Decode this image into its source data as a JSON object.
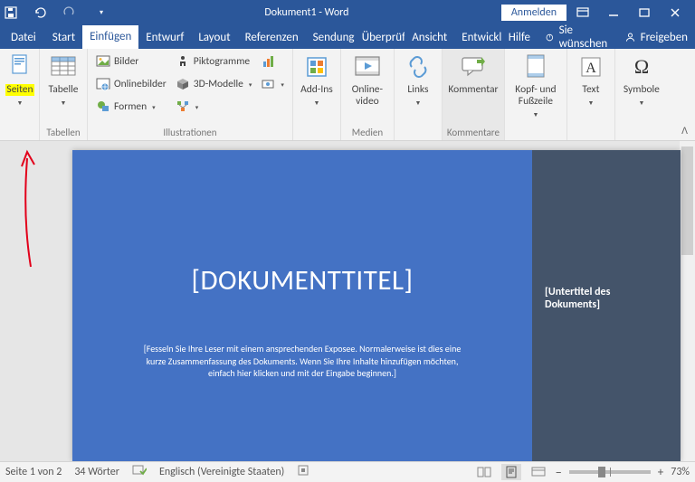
{
  "titlebar": {
    "doc": "Dokument1 - Word",
    "signin": "Anmelden"
  },
  "tabs": {
    "file": "Datei",
    "home": "Start",
    "insert": "Einfügen",
    "design": "Entwurf",
    "layout": "Layout",
    "references": "Referenzen",
    "mailings": "Sendungen",
    "review": "Überprüfen",
    "view": "Ansicht",
    "developer": "Entwickler",
    "help": "Hilfe",
    "tellme": "Sie wünschen",
    "share": "Freigeben"
  },
  "ribbon": {
    "pages": {
      "label": "Seiten"
    },
    "tables": {
      "btn": "Tabelle",
      "label": "Tabellen"
    },
    "illustrations": {
      "pictures": "Bilder",
      "online": "Onlinebilder",
      "shapes": "Formen",
      "icons": "Piktogramme",
      "models": "3D-Modelle",
      "label": "Illustrationen"
    },
    "addins": {
      "btn": "Add-Ins",
      "label": ""
    },
    "video": {
      "btn": "Online-video",
      "label": "Medien"
    },
    "links": {
      "btn": "Links"
    },
    "comment": {
      "btn": "Kommentar",
      "label": "Kommentare"
    },
    "header": {
      "btn": "Kopf- und Fußzeile"
    },
    "text": {
      "btn": "Text"
    },
    "symbols": {
      "btn": "Symbole"
    }
  },
  "document": {
    "title": "[DOKUMENTTITEL]",
    "subtitle": "[Untertitel des Dokuments]",
    "body": "[Fesseln Sie Ihre Leser mit einem ansprechenden Exposee. Normalerweise ist dies eine kurze Zusammenfassung des Dokuments. Wenn Sie Ihre Inhalte hinzufügen möchten, einfach hier klicken und mit der Eingabe beginnen.]"
  },
  "status": {
    "page": "Seite 1 von 2",
    "words": "34 Wörter",
    "lang": "Englisch (Vereinigte Staaten)",
    "zoom": "73%"
  }
}
